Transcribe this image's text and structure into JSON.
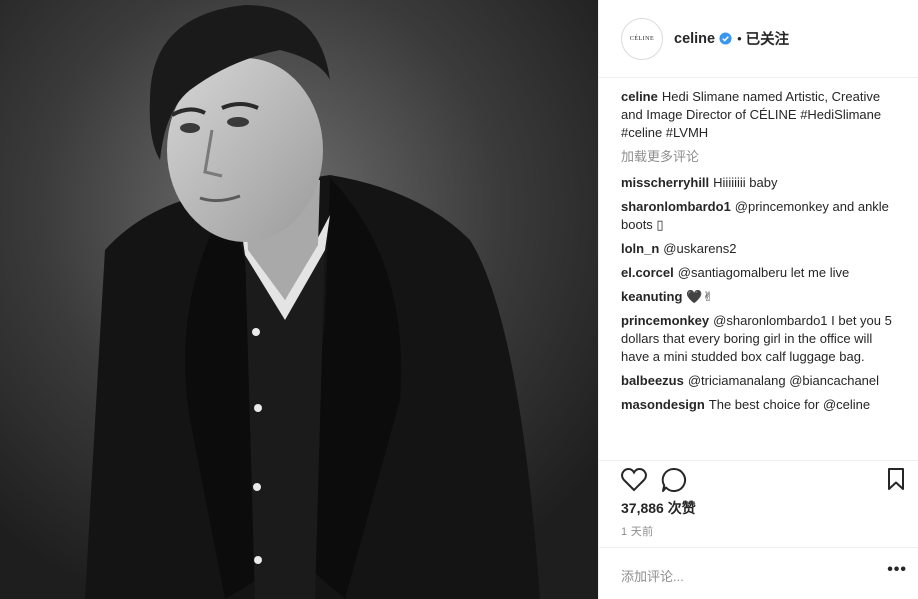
{
  "post": {
    "username": "celine",
    "avatar_text": "CÉLINE",
    "follow_status": "已关注",
    "separator": "•",
    "verified_icon": "verified-badge-icon"
  },
  "caption": {
    "username": "celine",
    "text": "Hedi Slimane named Artistic, Creative and Image Director of CÉLINE #HediSlimane #celine #LVMH"
  },
  "load_more_label": "加载更多评论",
  "comments": [
    {
      "username": "misscherryhill",
      "text": "Hiiiiiiii baby"
    },
    {
      "username": "sharonlombardo1",
      "text": "@princemonkey and ankle boots ▯"
    },
    {
      "username": "loln_n",
      "text": "@uskarens2"
    },
    {
      "username": "el.corcel",
      "text": "@santiagomalberu let me live"
    },
    {
      "username": "keanuting",
      "text": "🖤✌"
    },
    {
      "username": "princemonkey",
      "text": "@sharonlombardo1 I bet you 5 dollars that every boring girl in the office will have a mini studded box calf luggage bag."
    },
    {
      "username": "balbeezus",
      "text": "@triciamanalang @biancachanel"
    },
    {
      "username": "masondesign",
      "text": "The best choice for @celine"
    }
  ],
  "likes": "37,886 次赞",
  "timestamp": "1 天前",
  "add_comment_placeholder": "添加评论...",
  "more_options": "•••",
  "icons": {
    "like": "heart-icon",
    "comment": "comment-bubble-icon",
    "save": "bookmark-icon"
  }
}
